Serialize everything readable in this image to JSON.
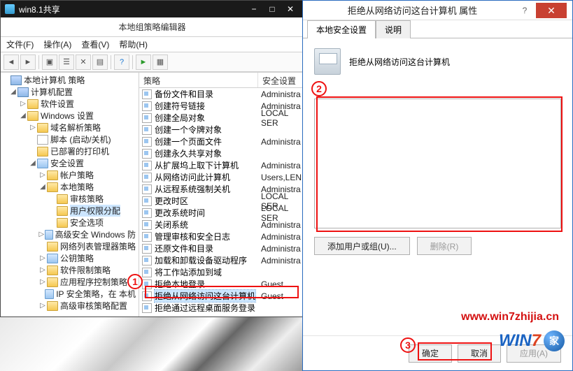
{
  "explorer_tab": "win8.1共享",
  "mmc_title": "本地组策略编辑器",
  "menus": {
    "file": "文件(F)",
    "action": "操作(A)",
    "view": "查看(V)",
    "help": "帮助(H)"
  },
  "tree_header": "本地计算机 策略",
  "tree": {
    "root": "计算机配置",
    "n_software": "软件设置",
    "n_windows": "Windows 设置",
    "n_dns": "域名解析策略",
    "n_script": "脚本 (启动/关机)",
    "n_printer": "已部署的打印机",
    "n_security": "安全设置",
    "n_account": "帐户策略",
    "n_local": "本地策略",
    "n_audit": "审核策略",
    "n_userrights": "用户权限分配",
    "n_secoptions": "安全选项",
    "n_adv": "高级安全 Windows 防",
    "n_netlist": "网络列表管理器策略",
    "n_pubkey": "公钥策略",
    "n_restrict": "软件限制策略",
    "n_appctrl": "应用程序控制策略",
    "n_ipsec": "IP 安全策略，在 本机",
    "n_advaudit": "高级审核策略配置"
  },
  "list_cols": {
    "policy": "策略",
    "setting": "安全设置"
  },
  "policies": [
    {
      "name": "备份文件和目录",
      "setting": "Administra"
    },
    {
      "name": "创建符号链接",
      "setting": "Administra"
    },
    {
      "name": "创建全局对象",
      "setting": "LOCAL SER"
    },
    {
      "name": "创建一个令牌对象",
      "setting": ""
    },
    {
      "name": "创建一个页面文件",
      "setting": "Administra"
    },
    {
      "name": "创建永久共享对象",
      "setting": ""
    },
    {
      "name": "从扩展坞上取下计算机",
      "setting": "Administra"
    },
    {
      "name": "从网络访问此计算机",
      "setting": "Users,LEN"
    },
    {
      "name": "从远程系统强制关机",
      "setting": "Administra"
    },
    {
      "name": "更改时区",
      "setting": "LOCAL SER"
    },
    {
      "name": "更改系统时间",
      "setting": "LOCAL SER"
    },
    {
      "name": "关闭系统",
      "setting": "Administra"
    },
    {
      "name": "管理审核和安全日志",
      "setting": "Administra"
    },
    {
      "name": "还原文件和目录",
      "setting": "Administra"
    },
    {
      "name": "加载和卸载设备驱动程序",
      "setting": "Administra"
    },
    {
      "name": "将工作站添加到域",
      "setting": ""
    },
    {
      "name": "拒绝本地登录",
      "setting": "Guest"
    },
    {
      "name": "拒绝从网络访问这台计算机",
      "setting": "Guest"
    },
    {
      "name": "拒绝通过远程桌面服务登录",
      "setting": ""
    }
  ],
  "dialog": {
    "title": "拒绝从网络访问这台计算机 属性",
    "tab_active": "本地安全设置",
    "tab_explain": "说明",
    "policy_label": "拒绝从网络访问这台计算机",
    "btn_add": "添加用户或组(U)...",
    "btn_remove": "删除(R)",
    "btn_ok": "确定",
    "btn_cancel": "取消",
    "btn_apply": "应用(A)"
  },
  "callouts": {
    "c1": "1",
    "c2": "2",
    "c3": "3"
  },
  "watermark": "www.win7zhijia.cn",
  "logo": {
    "w": "WIN",
    "seven": "7",
    "badge": "家"
  }
}
